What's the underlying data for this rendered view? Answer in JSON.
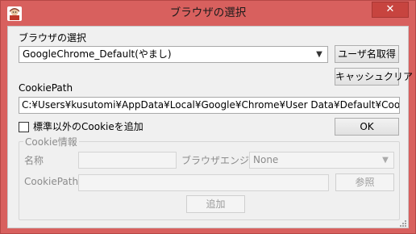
{
  "window": {
    "title": "ブラウザの選択",
    "close_glyph": "✕"
  },
  "browser_select": {
    "label": "ブラウザの選択",
    "value": "GoogleChrome_Default(やまし)",
    "get_username_label": "ユーザ名取得",
    "clear_cache_label": "キャッシュクリア"
  },
  "cookie_path": {
    "label": "CookiePath",
    "value": "C:¥Users¥kusutomi¥AppData¥Local¥Google¥Chrome¥User Data¥Default¥Cookies"
  },
  "non_standard": {
    "label": "標準以外のCookieを追加",
    "checked": false
  },
  "ok_label": "OK",
  "cookie_info": {
    "title": "Cookie情報",
    "name_label": "名称",
    "name_value": "",
    "engine_label": "ブラウザエンジン",
    "engine_value": "None",
    "path_label": "CookiePath",
    "path_value": "",
    "browse_label": "参照",
    "add_label": "追加"
  }
}
